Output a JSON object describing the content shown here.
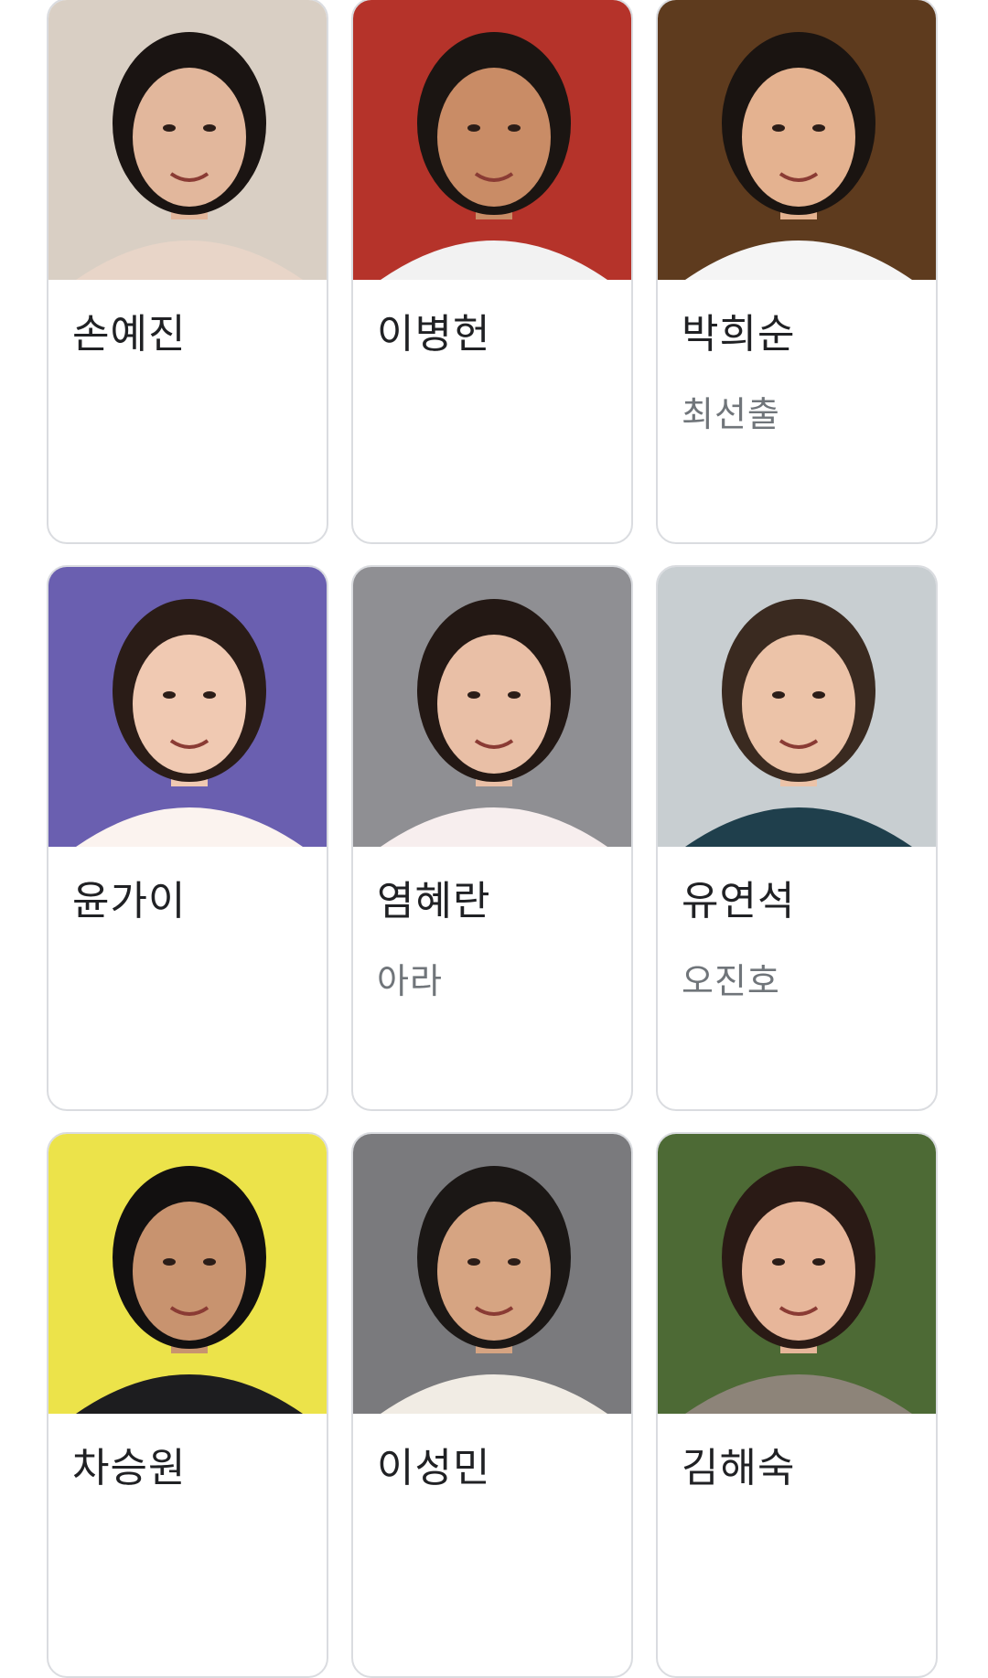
{
  "cast": [
    {
      "name": "손예진",
      "role": "",
      "photo_icon": "actor-photo",
      "bg": "#d9cfc4",
      "skin": "#e2b79c",
      "hair": "#1a1412",
      "shirt": "#e8d5c8"
    },
    {
      "name": "이병헌",
      "role": "",
      "photo_icon": "actor-photo",
      "bg": "#b5332a",
      "skin": "#c98c66",
      "hair": "#1b1512",
      "shirt": "#f2f2f2"
    },
    {
      "name": "박희순",
      "role": "최선출",
      "photo_icon": "actor-photo",
      "bg": "#5e3b1e",
      "skin": "#e4b290",
      "hair": "#1a1411",
      "shirt": "#f5f5f5"
    },
    {
      "name": "윤가이",
      "role": "",
      "photo_icon": "actor-photo",
      "bg": "#6a5fb0",
      "skin": "#f0c9b2",
      "hair": "#2a1c17",
      "shirt": "#fbf3ef"
    },
    {
      "name": "염혜란",
      "role": "아라",
      "photo_icon": "actor-photo",
      "bg": "#8f8f93",
      "skin": "#e9bfa6",
      "hair": "#231814",
      "shirt": "#f7eeee"
    },
    {
      "name": "유연석",
      "role": "오진호",
      "photo_icon": "actor-photo",
      "bg": "#c8ced1",
      "skin": "#ecc3a8",
      "hair": "#3a2a20",
      "shirt": "#1f3f4c"
    },
    {
      "name": "차승원",
      "role": "",
      "photo_icon": "actor-photo",
      "bg": "#ece34a",
      "skin": "#c8936f",
      "hair": "#121010",
      "shirt": "#1d1d1f"
    },
    {
      "name": "이성민",
      "role": "",
      "photo_icon": "actor-photo",
      "bg": "#7a7a7d",
      "skin": "#d6a482",
      "hair": "#1b1715",
      "shirt": "#f1ece4"
    },
    {
      "name": "김해숙",
      "role": "",
      "photo_icon": "actor-photo",
      "bg": "#4d6a35",
      "skin": "#e7b69a",
      "hair": "#2a1a15",
      "shirt": "#8d8479"
    }
  ]
}
